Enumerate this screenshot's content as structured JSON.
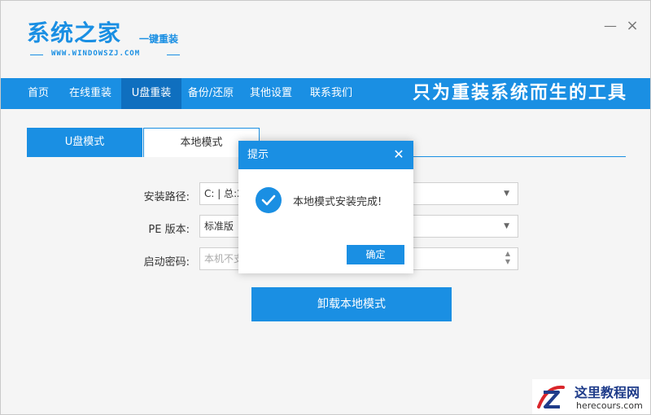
{
  "app": {
    "title": "系统之家",
    "subtitle": "一键重装",
    "url": "WWW.WINDOWSZJ.COM",
    "minimize_glyph": "—",
    "close_glyph": "×"
  },
  "nav": {
    "items": [
      {
        "label": "首页",
        "active": false
      },
      {
        "label": "在线重装",
        "active": false
      },
      {
        "label": "U盘重装",
        "active": true
      },
      {
        "label": "备份/还原",
        "active": false
      },
      {
        "label": "其他设置",
        "active": false
      },
      {
        "label": "联系我们",
        "active": false
      }
    ],
    "slogan": "只为重装系统而生的工具"
  },
  "tabs": [
    {
      "label": "U盘模式",
      "active": false
    },
    {
      "label": "本地模式",
      "active": true
    }
  ],
  "form": {
    "install_path": {
      "label": "安装路径:",
      "value": "C: | 总:2"
    },
    "pe_version": {
      "label": "PE 版本:",
      "value": "标准版"
    },
    "boot_password": {
      "label": "启动密码:",
      "placeholder": "本机不支"
    }
  },
  "uninstall_button": "卸载本地模式",
  "dialog": {
    "title": "提示",
    "message": "本地模式安装完成!",
    "ok_label": "确定",
    "icon": "check-circle-icon"
  },
  "watermark": {
    "cn": "这里教程网",
    "en": "herecours.com"
  },
  "colors": {
    "accent": "#1a8fe3",
    "nav_active": "#0f6fbf",
    "background": "#f5f5f5"
  }
}
